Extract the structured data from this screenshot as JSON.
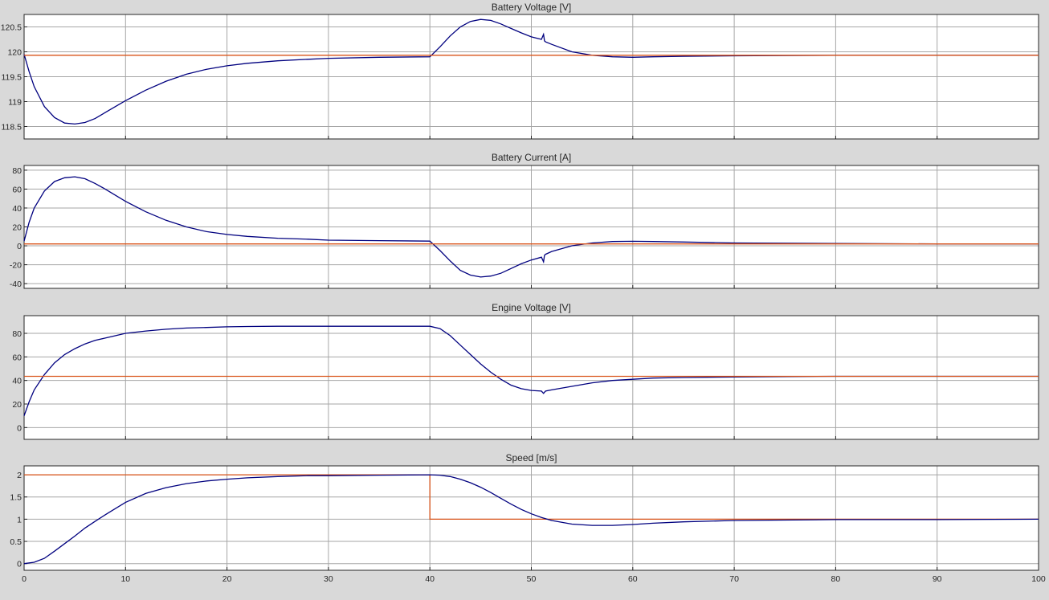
{
  "window": {
    "background": "#d9d9d9"
  },
  "chart_data": [
    {
      "type": "line",
      "title": "Battery Voltage [V]",
      "xlim": [
        0,
        100
      ],
      "ylim": [
        118.25,
        120.75
      ],
      "x_ticks": [
        0,
        10,
        20,
        30,
        40,
        50,
        60,
        70,
        80,
        90,
        100
      ],
      "y_ticks": [
        118.5,
        119,
        119.5,
        120,
        120.5
      ],
      "y_tick_labels": [
        "118.5",
        "119",
        "119.5",
        "120",
        "120.5"
      ],
      "x_tick_labels_shown": false,
      "grid": true,
      "series": [
        {
          "color": "#00007f",
          "x": [
            0,
            0.5,
            1,
            2,
            3,
            4,
            5,
            6,
            7,
            8,
            10,
            12,
            14,
            16,
            18,
            20,
            22,
            25,
            28,
            30,
            35,
            40,
            41,
            42,
            43,
            44,
            45,
            46,
            47,
            48,
            49,
            50,
            51,
            51.2,
            51.3,
            51.4,
            52,
            54,
            56,
            58,
            60,
            62,
            65,
            70,
            80,
            90,
            100
          ],
          "y": [
            119.95,
            119.6,
            119.3,
            118.9,
            118.68,
            118.57,
            118.55,
            118.58,
            118.66,
            118.78,
            119.02,
            119.23,
            119.41,
            119.55,
            119.65,
            119.72,
            119.77,
            119.82,
            119.85,
            119.87,
            119.89,
            119.9,
            120.1,
            120.32,
            120.5,
            120.61,
            120.65,
            120.63,
            120.56,
            120.47,
            120.38,
            120.3,
            120.25,
            120.35,
            120.22,
            120.2,
            120.15,
            120.0,
            119.93,
            119.9,
            119.89,
            119.9,
            119.91,
            119.92,
            119.93,
            119.93,
            119.93
          ]
        },
        {
          "color": "#d95319",
          "x": [
            0,
            100
          ],
          "y": [
            119.93,
            119.93
          ]
        }
      ]
    },
    {
      "type": "line",
      "title": "Battery Current [A]",
      "xlim": [
        0,
        100
      ],
      "ylim": [
        -45,
        85
      ],
      "x_ticks": [
        0,
        10,
        20,
        30,
        40,
        50,
        60,
        70,
        80,
        90,
        100
      ],
      "y_ticks": [
        -40,
        -20,
        0,
        20,
        40,
        60,
        80
      ],
      "y_tick_labels": [
        "-40",
        "-20",
        "0",
        "20",
        "40",
        "60",
        "80"
      ],
      "x_tick_labels_shown": false,
      "grid": true,
      "series": [
        {
          "color": "#00007f",
          "x": [
            0,
            0.5,
            1,
            2,
            3,
            4,
            5,
            6,
            7,
            8,
            10,
            12,
            14,
            16,
            18,
            20,
            22,
            25,
            28,
            30,
            35,
            40,
            41,
            42,
            43,
            44,
            45,
            46,
            47,
            48,
            49,
            50,
            51,
            51.2,
            51.3,
            51.4,
            52,
            54,
            56,
            58,
            60,
            62,
            65,
            70,
            80,
            90,
            100
          ],
          "y": [
            5,
            25,
            40,
            58,
            68,
            72,
            73,
            71,
            66,
            60,
            47,
            36,
            27,
            20,
            15,
            12,
            10,
            8,
            7,
            6,
            5.5,
            5,
            -5,
            -16,
            -26,
            -31,
            -33,
            -32,
            -29,
            -24,
            -19,
            -15,
            -12,
            -17,
            -10,
            -9,
            -6,
            0,
            3,
            4.5,
            4.8,
            4.5,
            4,
            3,
            2.5,
            2,
            2
          ]
        },
        {
          "color": "#d95319",
          "x": [
            0,
            100
          ],
          "y": [
            2,
            2
          ]
        }
      ]
    },
    {
      "type": "line",
      "title": "Engine Voltage [V]",
      "xlim": [
        0,
        100
      ],
      "ylim": [
        -10,
        95
      ],
      "x_ticks": [
        0,
        10,
        20,
        30,
        40,
        50,
        60,
        70,
        80,
        90,
        100
      ],
      "y_ticks": [
        0,
        20,
        40,
        60,
        80
      ],
      "y_tick_labels": [
        "0",
        "20",
        "40",
        "60",
        "80"
      ],
      "x_tick_labels_shown": false,
      "grid": true,
      "series": [
        {
          "color": "#00007f",
          "x": [
            0,
            0.5,
            1,
            2,
            3,
            4,
            5,
            6,
            7,
            8,
            10,
            12,
            14,
            16,
            18,
            20,
            22,
            25,
            28,
            30,
            35,
            40,
            41,
            42,
            43,
            44,
            45,
            46,
            47,
            48,
            49,
            50,
            51,
            51.2,
            51.3,
            51.4,
            52,
            54,
            56,
            58,
            60,
            62,
            65,
            70,
            80,
            90,
            100
          ],
          "y": [
            10,
            22,
            32,
            45,
            55,
            62,
            67,
            71,
            74,
            76,
            80,
            82,
            83.5,
            84.5,
            85,
            85.5,
            85.8,
            86,
            86,
            86,
            86,
            86,
            84,
            78,
            70,
            62,
            54,
            47,
            41,
            36,
            33,
            31.5,
            31,
            29,
            30,
            31,
            32,
            35,
            38,
            40,
            41,
            42,
            42.5,
            43,
            43.5,
            43.5,
            43.5
          ]
        },
        {
          "color": "#d95319",
          "x": [
            0,
            100
          ],
          "y": [
            43.5,
            43.5
          ]
        }
      ]
    },
    {
      "type": "line",
      "title": "Speed [m/s]",
      "xlim": [
        0,
        100
      ],
      "ylim": [
        -0.15,
        2.2
      ],
      "x_ticks": [
        0,
        10,
        20,
        30,
        40,
        50,
        60,
        70,
        80,
        90,
        100
      ],
      "x_tick_labels": [
        "0",
        "10",
        "20",
        "30",
        "40",
        "50",
        "60",
        "70",
        "80",
        "90",
        "100"
      ],
      "y_ticks": [
        0,
        0.5,
        1,
        1.5,
        2
      ],
      "y_tick_labels": [
        "0",
        "0.5",
        "1",
        "1.5",
        "2"
      ],
      "x_tick_labels_shown": true,
      "grid": true,
      "series": [
        {
          "color": "#d95319",
          "x": [
            0,
            40,
            40,
            100
          ],
          "y": [
            2,
            2,
            1,
            1
          ]
        },
        {
          "color": "#00007f",
          "x": [
            0,
            1,
            2,
            3,
            4,
            5,
            6,
            7,
            8,
            10,
            12,
            14,
            16,
            18,
            20,
            22,
            25,
            28,
            30,
            35,
            40,
            41,
            42,
            43,
            44,
            45,
            46,
            47,
            48,
            49,
            50,
            51,
            52,
            54,
            56,
            58,
            60,
            62,
            65,
            70,
            80,
            90,
            100
          ],
          "y": [
            0,
            0.03,
            0.12,
            0.28,
            0.45,
            0.62,
            0.8,
            0.95,
            1.1,
            1.38,
            1.58,
            1.71,
            1.8,
            1.86,
            1.9,
            1.93,
            1.96,
            1.98,
            1.98,
            1.99,
            2.0,
            1.99,
            1.96,
            1.9,
            1.82,
            1.72,
            1.6,
            1.47,
            1.34,
            1.22,
            1.12,
            1.04,
            0.97,
            0.89,
            0.86,
            0.86,
            0.88,
            0.91,
            0.94,
            0.97,
            0.99,
            0.99,
            1.0
          ]
        }
      ]
    }
  ]
}
